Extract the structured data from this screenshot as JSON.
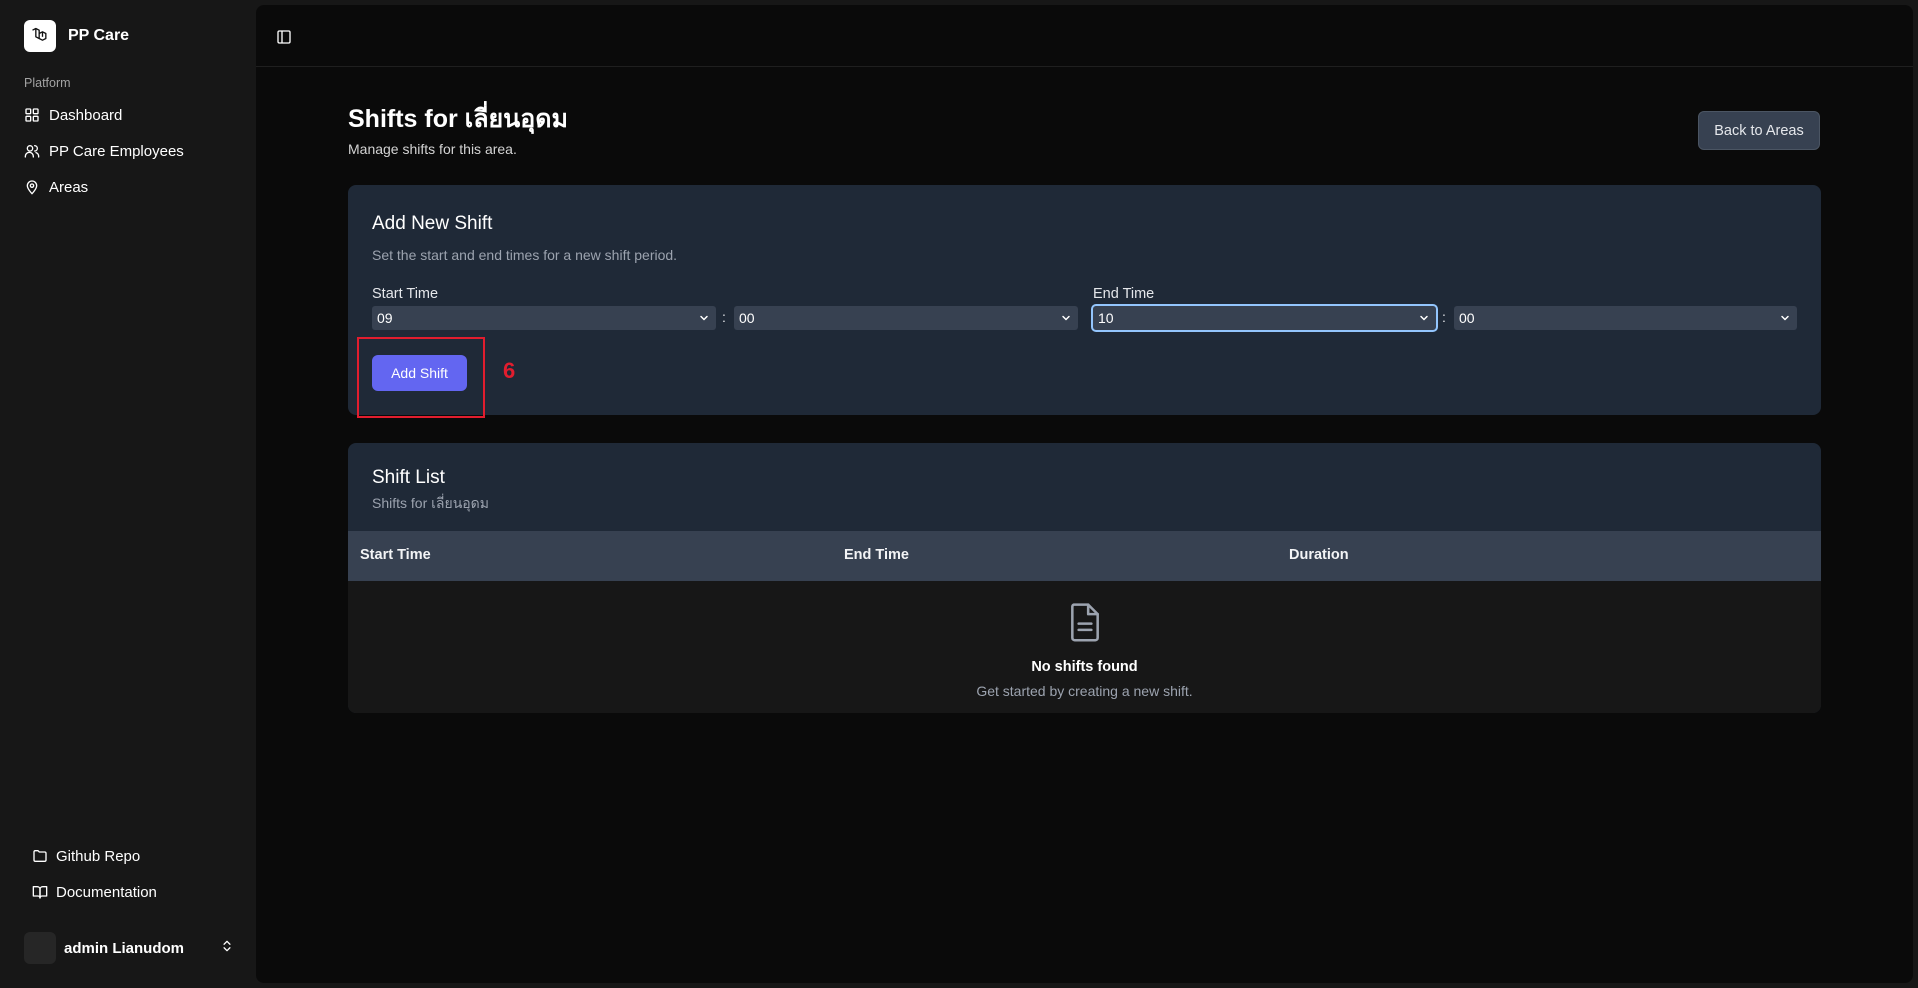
{
  "sidebar": {
    "brand_name": "PP Care",
    "group_label": "Platform",
    "items": [
      {
        "label": "Dashboard",
        "icon": "grid-icon"
      },
      {
        "label": "PP Care Employees",
        "icon": "users-icon"
      },
      {
        "label": "Areas",
        "icon": "map-pin-icon"
      }
    ],
    "footer_items": [
      {
        "label": "Github Repo",
        "icon": "folder-icon"
      },
      {
        "label": "Documentation",
        "icon": "book-open-icon"
      }
    ],
    "user_name": "admin Lianudom"
  },
  "page": {
    "title": "Shifts for เลี่ยนอุดม",
    "subtitle": "Manage shifts for this area.",
    "back_button": "Back to Areas"
  },
  "add_shift": {
    "title": "Add New Shift",
    "description": "Set the start and end times for a new shift period.",
    "start_label": "Start Time",
    "end_label": "End Time",
    "start_hour": "09",
    "start_minute": "00",
    "end_hour": "10",
    "end_minute": "00",
    "separator": ":",
    "submit_label": "Add Shift",
    "annotation": "6"
  },
  "shift_list": {
    "title": "Shift List",
    "subtitle": "Shifts for เลี่ยนอุดม",
    "columns": [
      "Start Time",
      "End Time",
      "Duration"
    ],
    "empty_title": "No shifts found",
    "empty_description": "Get started by creating a new shift."
  },
  "colors": {
    "accent": "#6366f1",
    "card": "#1f2937",
    "annotation": "#e11d2e"
  }
}
